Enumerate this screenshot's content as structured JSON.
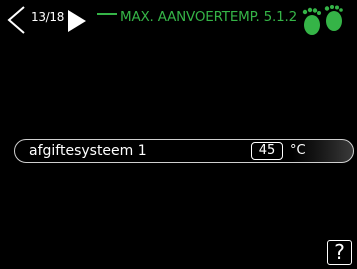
{
  "header": {
    "page_indicator": "13/18",
    "menu_title": "MAX. AANVOERTEMP. 5.1.2",
    "accent_color": "#35b447",
    "icons": {
      "prev": "chevron-left-icon",
      "next": "play-right-icon",
      "brand": "footprints-icon"
    }
  },
  "setting": {
    "label": "afgiftesysteem 1",
    "value": "45",
    "unit": "°C"
  },
  "help": {
    "label": "?"
  }
}
